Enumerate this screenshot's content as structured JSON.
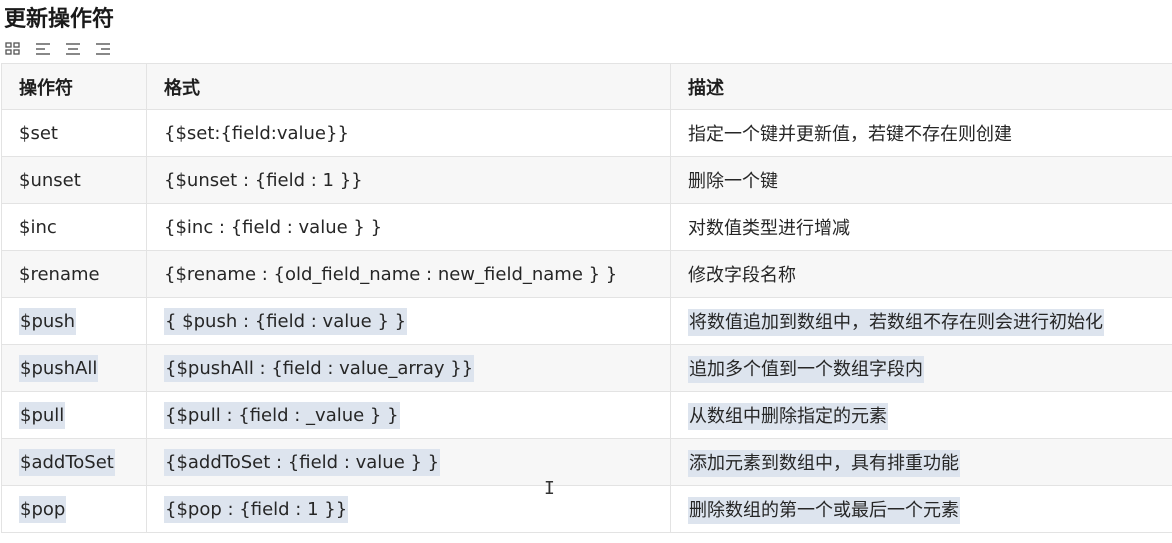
{
  "title": "更新操作符",
  "toolbar": {
    "icons": [
      "grid-icon",
      "align-left-icon",
      "align-center-icon",
      "align-right-icon"
    ]
  },
  "table": {
    "headers": [
      "操作符",
      "格式",
      "描述"
    ],
    "rows": [
      {
        "op": "$set",
        "format": "{$set:{field:value}}",
        "desc": "指定一个键并更新值，若键不存在则创建",
        "highlight": false
      },
      {
        "op": "$unset",
        "format": "{$unset : {field : 1 }}",
        "desc": "删除一个键",
        "highlight": false
      },
      {
        "op": "$inc",
        "format": "{$inc : {field : value } }",
        "desc": "对数值类型进行增减",
        "highlight": false
      },
      {
        "op": "$rename",
        "format": "{$rename : {old_field_name : new_field_name } }",
        "desc": "修改字段名称",
        "highlight": false
      },
      {
        "op": "$push",
        "format": "{ $push : {field : value } }",
        "desc": "将数值追加到数组中，若数组不存在则会进行初始化",
        "highlight": true
      },
      {
        "op": "$pushAll",
        "format": "{$pushAll : {field : value_array }}",
        "desc": "追加多个值到一个数组字段内",
        "highlight": true
      },
      {
        "op": "$pull",
        "format": "{$pull : {field : _value } }",
        "desc": "从数组中删除指定的元素",
        "highlight": true
      },
      {
        "op": "$addToSet",
        "format": "{$addToSet : {field : value } }",
        "desc": "添加元素到数组中，具有排重功能",
        "highlight": true
      },
      {
        "op": "$pop",
        "format": "{$pop : {field : 1 }}",
        "desc": "删除数组的第一个或最后一个元素",
        "highlight": true
      }
    ]
  },
  "colors": {
    "selection": "#dde4ee",
    "border": "#e3e3e3",
    "header_bg": "#f7f7f7"
  }
}
